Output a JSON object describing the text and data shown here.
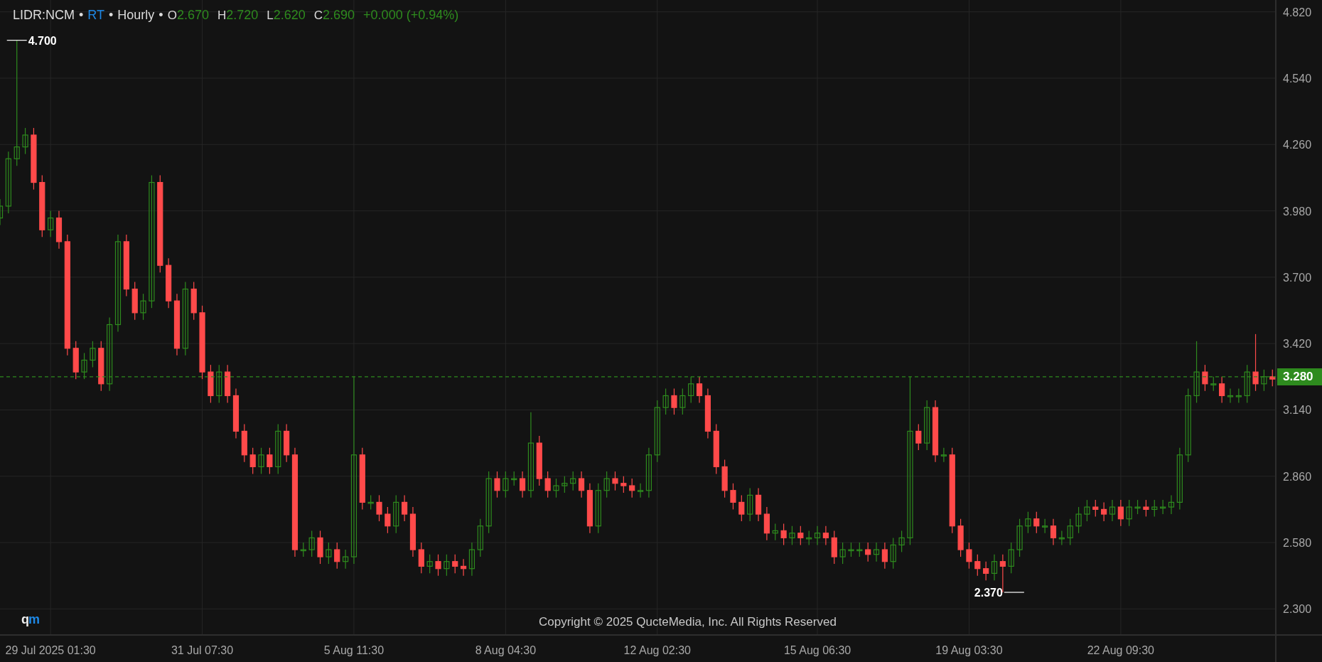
{
  "header": {
    "symbol": "LIDR:NCM",
    "separator": "•",
    "feed": "RT",
    "interval": "Hourly",
    "quotes": [
      {
        "label": "O",
        "value": "2.670"
      },
      {
        "label": "H",
        "value": "2.720"
      },
      {
        "label": "L",
        "value": "2.620"
      },
      {
        "label": "C",
        "value": "2.690"
      }
    ],
    "change": "+0.000 (+0.94%)"
  },
  "chart": {
    "chart_data": {
      "type": "candlestick",
      "grid": true,
      "categories": [
        null,
        null,
        null,
        null,
        null,
        null,
        "29 Jul 2025 01:30",
        null,
        null,
        null,
        null,
        null,
        null,
        null,
        null,
        null,
        null,
        null,
        null,
        null,
        null,
        null,
        null,
        null,
        "31 Jul 07:30",
        null,
        null,
        null,
        null,
        null,
        null,
        null,
        null,
        null,
        null,
        null,
        null,
        null,
        null,
        null,
        null,
        null,
        "5 Aug 11:30",
        null,
        null,
        null,
        null,
        null,
        null,
        null,
        null,
        null,
        null,
        null,
        null,
        null,
        null,
        null,
        null,
        null,
        "8 Aug 04:30",
        null,
        null,
        null,
        null,
        null,
        null,
        null,
        null,
        null,
        null,
        null,
        null,
        null,
        null,
        null,
        null,
        null,
        "12 Aug 02:30",
        null,
        null,
        null,
        null,
        null,
        null,
        null,
        null,
        null,
        null,
        null,
        null,
        null,
        null,
        null,
        null,
        null,
        null,
        "15 Aug 06:30",
        null,
        null,
        null,
        null,
        null,
        null,
        null,
        null,
        null,
        null,
        null,
        null,
        null,
        null,
        null,
        null,
        null,
        "19 Aug 03:30",
        null,
        null,
        null,
        null,
        null,
        null,
        null,
        null,
        null,
        null,
        null,
        null,
        null,
        null,
        null,
        null,
        null,
        "22 Aug 09:30",
        null,
        null,
        null,
        null,
        null,
        null,
        null,
        null,
        null,
        null,
        null,
        null,
        null,
        null,
        null,
        null,
        null,
        null
      ],
      "ohlc": [
        [
          3.95,
          4.03,
          3.92,
          4.0
        ],
        [
          4.0,
          4.23,
          3.97,
          4.2
        ],
        [
          4.2,
          4.7,
          4.17,
          4.25
        ],
        [
          4.25,
          4.33,
          4.22,
          4.3
        ],
        [
          4.3,
          4.33,
          4.07,
          4.1
        ],
        [
          4.1,
          4.13,
          3.87,
          3.9
        ],
        [
          3.9,
          3.98,
          3.87,
          3.95
        ],
        [
          3.95,
          3.98,
          3.82,
          3.85
        ],
        [
          3.85,
          3.88,
          3.37,
          3.4
        ],
        [
          3.4,
          3.43,
          3.27,
          3.3
        ],
        [
          3.3,
          3.38,
          3.27,
          3.35
        ],
        [
          3.35,
          3.43,
          3.32,
          3.4
        ],
        [
          3.4,
          3.43,
          3.22,
          3.25
        ],
        [
          3.25,
          3.53,
          3.22,
          3.5
        ],
        [
          3.5,
          3.88,
          3.47,
          3.85
        ],
        [
          3.85,
          3.88,
          3.62,
          3.65
        ],
        [
          3.65,
          3.68,
          3.52,
          3.55
        ],
        [
          3.55,
          3.63,
          3.52,
          3.6
        ],
        [
          3.6,
          4.13,
          3.57,
          4.1
        ],
        [
          4.1,
          4.13,
          3.72,
          3.75
        ],
        [
          3.75,
          3.78,
          3.57,
          3.6
        ],
        [
          3.6,
          3.63,
          3.37,
          3.4
        ],
        [
          3.4,
          3.68,
          3.37,
          3.65
        ],
        [
          3.65,
          3.68,
          3.52,
          3.55
        ],
        [
          3.55,
          3.58,
          3.27,
          3.3
        ],
        [
          3.3,
          3.33,
          3.17,
          3.2
        ],
        [
          3.2,
          3.33,
          3.17,
          3.3
        ],
        [
          3.3,
          3.33,
          3.17,
          3.2
        ],
        [
          3.2,
          3.23,
          3.02,
          3.05
        ],
        [
          3.05,
          3.08,
          2.92,
          2.95
        ],
        [
          2.95,
          2.98,
          2.87,
          2.9
        ],
        [
          2.9,
          2.98,
          2.87,
          2.95
        ],
        [
          2.95,
          2.98,
          2.87,
          2.9
        ],
        [
          2.9,
          3.08,
          2.87,
          3.05
        ],
        [
          3.05,
          3.08,
          2.92,
          2.95
        ],
        [
          2.95,
          2.98,
          2.52,
          2.55
        ],
        [
          2.55,
          2.58,
          2.52,
          2.55
        ],
        [
          2.55,
          2.63,
          2.52,
          2.6
        ],
        [
          2.6,
          2.63,
          2.49,
          2.52
        ],
        [
          2.52,
          2.58,
          2.49,
          2.55
        ],
        [
          2.55,
          2.58,
          2.47,
          2.5
        ],
        [
          2.5,
          2.55,
          2.47,
          2.52
        ],
        [
          2.52,
          3.28,
          2.49,
          2.95
        ],
        [
          2.95,
          2.98,
          2.72,
          2.75
        ],
        [
          2.75,
          2.78,
          2.72,
          2.75
        ],
        [
          2.75,
          2.78,
          2.67,
          2.7
        ],
        [
          2.7,
          2.73,
          2.62,
          2.65
        ],
        [
          2.65,
          2.78,
          2.62,
          2.75
        ],
        [
          2.75,
          2.78,
          2.67,
          2.7
        ],
        [
          2.7,
          2.73,
          2.52,
          2.55
        ],
        [
          2.55,
          2.58,
          2.45,
          2.48
        ],
        [
          2.48,
          2.53,
          2.45,
          2.5
        ],
        [
          2.5,
          2.53,
          2.44,
          2.47
        ],
        [
          2.47,
          2.53,
          2.44,
          2.5
        ],
        [
          2.5,
          2.53,
          2.45,
          2.48
        ],
        [
          2.48,
          2.51,
          2.44,
          2.47
        ],
        [
          2.47,
          2.58,
          2.44,
          2.55
        ],
        [
          2.55,
          2.68,
          2.52,
          2.65
        ],
        [
          2.65,
          2.88,
          2.62,
          2.85
        ],
        [
          2.85,
          2.88,
          2.77,
          2.8
        ],
        [
          2.8,
          2.88,
          2.77,
          2.85
        ],
        [
          2.85,
          2.88,
          2.82,
          2.85
        ],
        [
          2.85,
          2.88,
          2.77,
          2.8
        ],
        [
          2.8,
          3.13,
          2.77,
          3.0
        ],
        [
          3.0,
          3.03,
          2.82,
          2.85
        ],
        [
          2.85,
          2.88,
          2.77,
          2.8
        ],
        [
          2.8,
          2.85,
          2.77,
          2.82
        ],
        [
          2.82,
          2.86,
          2.79,
          2.83
        ],
        [
          2.83,
          2.88,
          2.8,
          2.85
        ],
        [
          2.85,
          2.88,
          2.77,
          2.8
        ],
        [
          2.8,
          2.83,
          2.62,
          2.65
        ],
        [
          2.65,
          2.83,
          2.62,
          2.8
        ],
        [
          2.8,
          2.88,
          2.77,
          2.85
        ],
        [
          2.85,
          2.88,
          2.8,
          2.83
        ],
        [
          2.83,
          2.86,
          2.79,
          2.82
        ],
        [
          2.82,
          2.85,
          2.77,
          2.8
        ],
        [
          2.8,
          2.83,
          2.77,
          2.8
        ],
        [
          2.8,
          2.98,
          2.77,
          2.95
        ],
        [
          2.95,
          3.18,
          2.92,
          3.15
        ],
        [
          3.15,
          3.23,
          3.12,
          3.2
        ],
        [
          3.2,
          3.23,
          3.12,
          3.15
        ],
        [
          3.15,
          3.23,
          3.12,
          3.2
        ],
        [
          3.2,
          3.28,
          3.17,
          3.25
        ],
        [
          3.25,
          3.28,
          3.17,
          3.2
        ],
        [
          3.2,
          3.23,
          3.02,
          3.05
        ],
        [
          3.05,
          3.08,
          2.87,
          2.9
        ],
        [
          2.9,
          2.93,
          2.77,
          2.8
        ],
        [
          2.8,
          2.83,
          2.72,
          2.75
        ],
        [
          2.75,
          2.78,
          2.67,
          2.7
        ],
        [
          2.7,
          2.81,
          2.67,
          2.78
        ],
        [
          2.78,
          2.81,
          2.67,
          2.7
        ],
        [
          2.7,
          2.73,
          2.59,
          2.62
        ],
        [
          2.62,
          2.66,
          2.59,
          2.63
        ],
        [
          2.63,
          2.66,
          2.57,
          2.6
        ],
        [
          2.6,
          2.65,
          2.57,
          2.62
        ],
        [
          2.62,
          2.65,
          2.57,
          2.6
        ],
        [
          2.6,
          2.63,
          2.57,
          2.6
        ],
        [
          2.6,
          2.65,
          2.57,
          2.62
        ],
        [
          2.62,
          2.65,
          2.57,
          2.6
        ],
        [
          2.6,
          2.63,
          2.49,
          2.52
        ],
        [
          2.52,
          2.58,
          2.49,
          2.55
        ],
        [
          2.55,
          2.58,
          2.52,
          2.55
        ],
        [
          2.55,
          2.58,
          2.52,
          2.55
        ],
        [
          2.55,
          2.58,
          2.5,
          2.53
        ],
        [
          2.53,
          2.58,
          2.5,
          2.55
        ],
        [
          2.55,
          2.58,
          2.47,
          2.5
        ],
        [
          2.5,
          2.6,
          2.47,
          2.57
        ],
        [
          2.57,
          2.63,
          2.54,
          2.6
        ],
        [
          2.6,
          3.28,
          2.57,
          3.05
        ],
        [
          3.05,
          3.08,
          2.97,
          3.0
        ],
        [
          3.0,
          3.18,
          2.97,
          3.15
        ],
        [
          3.15,
          3.18,
          2.92,
          2.95
        ],
        [
          2.95,
          2.98,
          2.92,
          2.95
        ],
        [
          2.95,
          2.98,
          2.62,
          2.65
        ],
        [
          2.65,
          2.68,
          2.52,
          2.55
        ],
        [
          2.55,
          2.58,
          2.47,
          2.5
        ],
        [
          2.5,
          2.53,
          2.44,
          2.47
        ],
        [
          2.47,
          2.5,
          2.42,
          2.45
        ],
        [
          2.45,
          2.53,
          2.42,
          2.5
        ],
        [
          2.5,
          2.53,
          2.37,
          2.48
        ],
        [
          2.48,
          2.58,
          2.45,
          2.55
        ],
        [
          2.55,
          2.68,
          2.52,
          2.65
        ],
        [
          2.65,
          2.71,
          2.62,
          2.68
        ],
        [
          2.68,
          2.71,
          2.62,
          2.65
        ],
        [
          2.65,
          2.68,
          2.62,
          2.65
        ],
        [
          2.65,
          2.68,
          2.57,
          2.6
        ],
        [
          2.6,
          2.63,
          2.57,
          2.6
        ],
        [
          2.6,
          2.68,
          2.57,
          2.65
        ],
        [
          2.65,
          2.73,
          2.62,
          2.7
        ],
        [
          2.7,
          2.76,
          2.67,
          2.73
        ],
        [
          2.73,
          2.76,
          2.69,
          2.72
        ],
        [
          2.72,
          2.75,
          2.67,
          2.7
        ],
        [
          2.7,
          2.76,
          2.67,
          2.73
        ],
        [
          2.73,
          2.76,
          2.65,
          2.68
        ],
        [
          2.68,
          2.76,
          2.65,
          2.73
        ],
        [
          2.73,
          2.76,
          2.7,
          2.73
        ],
        [
          2.73,
          2.76,
          2.69,
          2.72
        ],
        [
          2.72,
          2.76,
          2.69,
          2.73
        ],
        [
          2.73,
          2.76,
          2.7,
          2.73
        ],
        [
          2.73,
          2.78,
          2.7,
          2.75
        ],
        [
          2.75,
          2.98,
          2.72,
          2.95
        ],
        [
          2.95,
          3.23,
          2.92,
          3.2
        ],
        [
          3.2,
          3.43,
          3.17,
          3.3
        ],
        [
          3.3,
          3.33,
          3.22,
          3.25
        ],
        [
          3.25,
          3.28,
          3.22,
          3.25
        ],
        [
          3.25,
          3.28,
          3.17,
          3.2
        ],
        [
          3.2,
          3.23,
          3.17,
          3.2
        ],
        [
          3.2,
          3.23,
          3.17,
          3.2
        ],
        [
          3.2,
          3.33,
          3.17,
          3.3
        ],
        [
          3.3,
          3.46,
          3.22,
          3.25
        ],
        [
          3.25,
          3.31,
          3.22,
          3.28
        ],
        [
          3.28,
          3.31,
          3.24,
          3.27
        ]
      ],
      "ylim": [
        2.19,
        4.87
      ],
      "yticks": [
        {
          "value": 4.82,
          "label": "4.820"
        },
        {
          "value": 4.54,
          "label": "4.540"
        },
        {
          "value": 4.26,
          "label": "4.260"
        },
        {
          "value": 3.98,
          "label": "3.980"
        },
        {
          "value": 3.7,
          "label": "3.700"
        },
        {
          "value": 3.42,
          "label": "3.420"
        },
        {
          "value": 3.14,
          "label": "3.140"
        },
        {
          "value": 2.86,
          "label": "2.860"
        },
        {
          "value": 2.58,
          "label": "2.580"
        },
        {
          "value": 2.3,
          "label": "2.300"
        }
      ],
      "annotations": [
        "4.700",
        "2.370"
      ],
      "ref_lines": [
        {
          "axis": "y",
          "value": 3.28,
          "label": "3.280",
          "color": "#2e8b1e"
        }
      ]
    }
  },
  "footer": {
    "logo": {
      "part_1": "q",
      "part_2": "m"
    },
    "copyright": "Copyright © 2025 QucteMedia, Inc. All Rights Reserved"
  }
}
